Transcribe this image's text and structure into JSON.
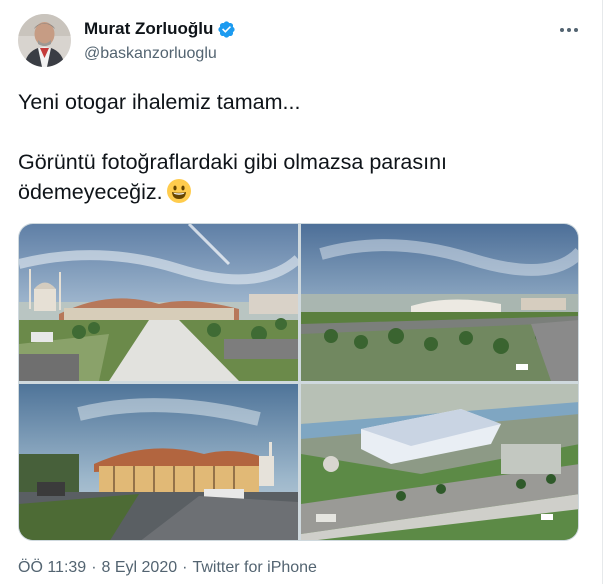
{
  "author": {
    "display_name": "Murat Zorluoğlu",
    "handle": "@baskanzorluoglu",
    "verified": true,
    "avatar_icon": "profile-photo"
  },
  "tweet": {
    "line1": "Yeni otogar ihalemiz tamam...",
    "line2": "Görüntü fotoğraflardaki gibi olmazsa parasını ödemeyeceğiz.",
    "emoji": "grinning-face-emoji"
  },
  "media": {
    "photos": [
      {
        "alt": "bus-terminal-render-front-mosque"
      },
      {
        "alt": "bus-terminal-render-parking-aerial"
      },
      {
        "alt": "bus-terminal-render-entrance-evening"
      },
      {
        "alt": "bus-terminal-render-top-aerial"
      }
    ]
  },
  "footer": {
    "time": "ÖÖ 11:39",
    "separator1": "·",
    "date": "8 Eyl 2020",
    "separator2": "·",
    "source": "Twitter for iPhone"
  },
  "colors": {
    "text": "#0f1419",
    "secondary": "#536471",
    "verified": "#1d9bf0",
    "border": "#cfd9de"
  }
}
